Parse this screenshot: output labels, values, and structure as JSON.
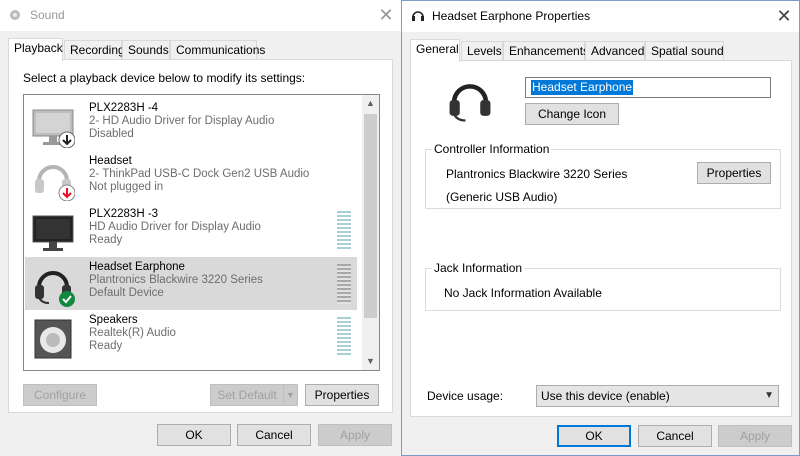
{
  "sound": {
    "title": "Sound",
    "close_glyph": "✕",
    "tabs": [
      {
        "label": "Playback"
      },
      {
        "label": "Recording"
      },
      {
        "label": "Sounds"
      },
      {
        "label": "Communications"
      }
    ],
    "instruction": "Select a playback device below to modify its settings:",
    "devices": [
      {
        "name": "PLX2283H -4",
        "driver": "2- HD Audio Driver for Display Audio",
        "status": "Disabled",
        "icon": "monitor-icon",
        "badge": "down-arrow-badge-icon"
      },
      {
        "name": "Headset",
        "driver": "2- ThinkPad USB-C Dock Gen2 USB Audio",
        "status": "Not plugged in",
        "icon": "headset-icon",
        "badge": "red-down-arrow-badge-icon"
      },
      {
        "name": "PLX2283H -3",
        "driver": "HD Audio Driver for Display Audio",
        "status": "Ready",
        "icon": "monitor-icon",
        "badge": ""
      },
      {
        "name": "Headset Earphone",
        "driver": "Plantronics Blackwire 3220 Series",
        "status": "Default Device",
        "icon": "headset-icon",
        "badge": "green-check-badge-icon"
      },
      {
        "name": "Speakers",
        "driver": "Realtek(R) Audio",
        "status": "Ready",
        "icon": "speaker-icon",
        "badge": ""
      }
    ],
    "buttons": {
      "configure": "Configure",
      "set_default": "Set Default",
      "properties": "Properties",
      "ok": "OK",
      "cancel": "Cancel",
      "apply": "Apply"
    }
  },
  "props": {
    "title": "Headset Earphone Properties",
    "close_glyph": "✕",
    "tabs": [
      {
        "label": "General"
      },
      {
        "label": "Levels"
      },
      {
        "label": "Enhancements"
      },
      {
        "label": "Advanced"
      },
      {
        "label": "Spatial sound"
      }
    ],
    "device_name_value": "Headset Earphone",
    "change_icon_label": "Change Icon",
    "controller": {
      "title": "Controller Information",
      "name": "Plantronics Blackwire 3220 Series",
      "sub": "(Generic USB Audio)",
      "properties_label": "Properties"
    },
    "jack": {
      "title": "Jack Information",
      "text": "No Jack Information Available"
    },
    "device_usage_label": "Device usage:",
    "device_usage_value": "Use this device (enable)",
    "buttons": {
      "ok": "OK",
      "cancel": "Cancel",
      "apply": "Apply"
    }
  },
  "colors": {
    "accent": "#0078d7",
    "selection_bg": "#d9d9d9",
    "level_meter": "#a9d0d9",
    "check_green": "#10893e",
    "warn_red": "#e81123"
  }
}
